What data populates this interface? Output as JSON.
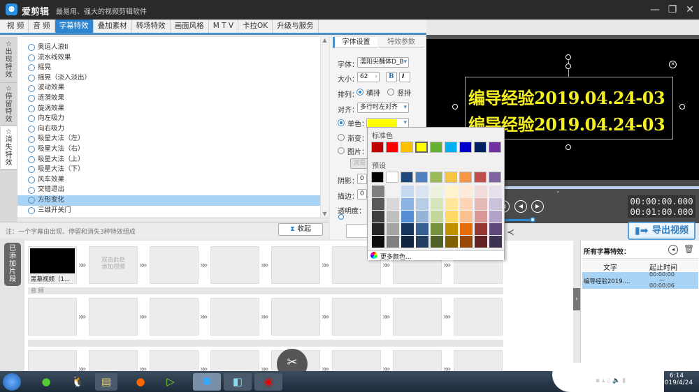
{
  "app": {
    "name": "爱剪辑",
    "slogan": "最易用、强大的视频剪辑软件",
    "window_controls": {
      "minimize": "—",
      "restore": "❐",
      "close": "✕"
    }
  },
  "menu": [
    {
      "label": "视 频"
    },
    {
      "label": "音 频"
    },
    {
      "label": "字幕特效",
      "active": true
    },
    {
      "label": "叠加素材"
    },
    {
      "label": "转场特效"
    },
    {
      "label": "画面风格"
    },
    {
      "label": "M T V"
    },
    {
      "label": "卡拉OK"
    },
    {
      "label": "升级与服务"
    }
  ],
  "effect_tabs": [
    {
      "label": "出现特效"
    },
    {
      "label": "停留特效"
    },
    {
      "label": "消失特效",
      "active": true
    }
  ],
  "effects": [
    "奥运人浪II",
    "流水线效果",
    "摇晃",
    "摇晃（淡入淡出）",
    "波动效果",
    "涟漪效果",
    "旋涡效果",
    "向左吸力",
    "向右吸力",
    "吸星大法（左）",
    "吸星大法（右）",
    "吸星大法（上）",
    "吸星大法（下）",
    "风车效果",
    "交错退出",
    "方形变化",
    "三维开关门"
  ],
  "selected_effect": "方形变化",
  "note": "注：一个字幕由出现、停留和消失3种特效组成",
  "collapse_label": "收起",
  "settings": {
    "tabs": [
      "字体设置",
      "特效参数"
    ],
    "font_label": "字体：",
    "font_value": "濡阳尖魏体D_B",
    "size_label": "大小：",
    "size_value": "62",
    "bold": "B",
    "italic": "I",
    "arrange_label": "排列：",
    "arrange_h": "横排",
    "arrange_v": "竖排",
    "align_label": "对齐：",
    "align_value": "多行时左对齐",
    "solid_label": "单色：",
    "solid_color": "#ffff00",
    "gradient_label": "渐变：",
    "image_label": "图片：",
    "browse": "浏览",
    "shadow_label": "阴影：",
    "shadow_value": "0",
    "stroke_label": "描边：",
    "stroke_value": "0",
    "opacity_label": "透明度："
  },
  "color_popup": {
    "standard_label": "标准色",
    "standard": [
      "#c00000",
      "#ff0000",
      "#ffc000",
      "#ffff00",
      "#66b032",
      "#00b0f0",
      "#0000cc",
      "#002060",
      "#7030a0"
    ],
    "preset_label": "预设",
    "preset": [
      "#000000",
      "#ffffff",
      "#1f497d",
      "#4f81bd",
      "#9bbb59",
      "#f8c444",
      "#f79646",
      "#c0504d",
      "#8064a2"
    ],
    "shades": [
      [
        "#7f7f7f",
        "#595959",
        "#3f3f3f",
        "#262626",
        "#0c0c0c"
      ],
      [
        "#f2f2f2",
        "#d8d8d8",
        "#bfbfbf",
        "#a5a5a5",
        "#7f7f7f"
      ],
      [
        "#c6d9f0",
        "#8db3e2",
        "#548dd4",
        "#17365d",
        "#0f243e"
      ],
      [
        "#dbe5f1",
        "#b8cce4",
        "#95b3d7",
        "#366092",
        "#244061"
      ],
      [
        "#ebf1dd",
        "#d7e3bc",
        "#c3d69b",
        "#76923c",
        "#4f6128"
      ],
      [
        "#fff2cc",
        "#ffe699",
        "#ffd966",
        "#bf9000",
        "#7f6000"
      ],
      [
        "#fdeada",
        "#fbd5b5",
        "#fac08f",
        "#e36c09",
        "#974806"
      ],
      [
        "#f2dcdb",
        "#e5b9b7",
        "#d99694",
        "#953734",
        "#632423"
      ],
      [
        "#e5e0ec",
        "#ccc1d9",
        "#b2a2c7",
        "#5f497a",
        "#3f3151"
      ]
    ],
    "more_colors": "更多颜色..."
  },
  "preview": {
    "caption_lines": [
      "编导经验2019.04.24-03",
      "编导经验2019.04.24-03"
    ],
    "caption_color": "#f5f020"
  },
  "player": {
    "current_time": "00:00:00.000",
    "total_time": "00:01:00.000"
  },
  "export_label": "导出视频",
  "timeline": {
    "side_label": "已添加片段",
    "clip_name": "黑幕视频（1...",
    "add_hint": "双击此处添加视频",
    "audio_label": "音 频"
  },
  "subtitles": {
    "title": "所有字幕特效：",
    "columns": [
      "文字",
      "起止时间"
    ],
    "rows": [
      {
        "text": "编导经验2019....",
        "start": "00:00:00",
        "sep": "—",
        "end": "00:00:06"
      }
    ]
  },
  "taskbar": {
    "time": "6:14",
    "date": "2019/4/24"
  }
}
